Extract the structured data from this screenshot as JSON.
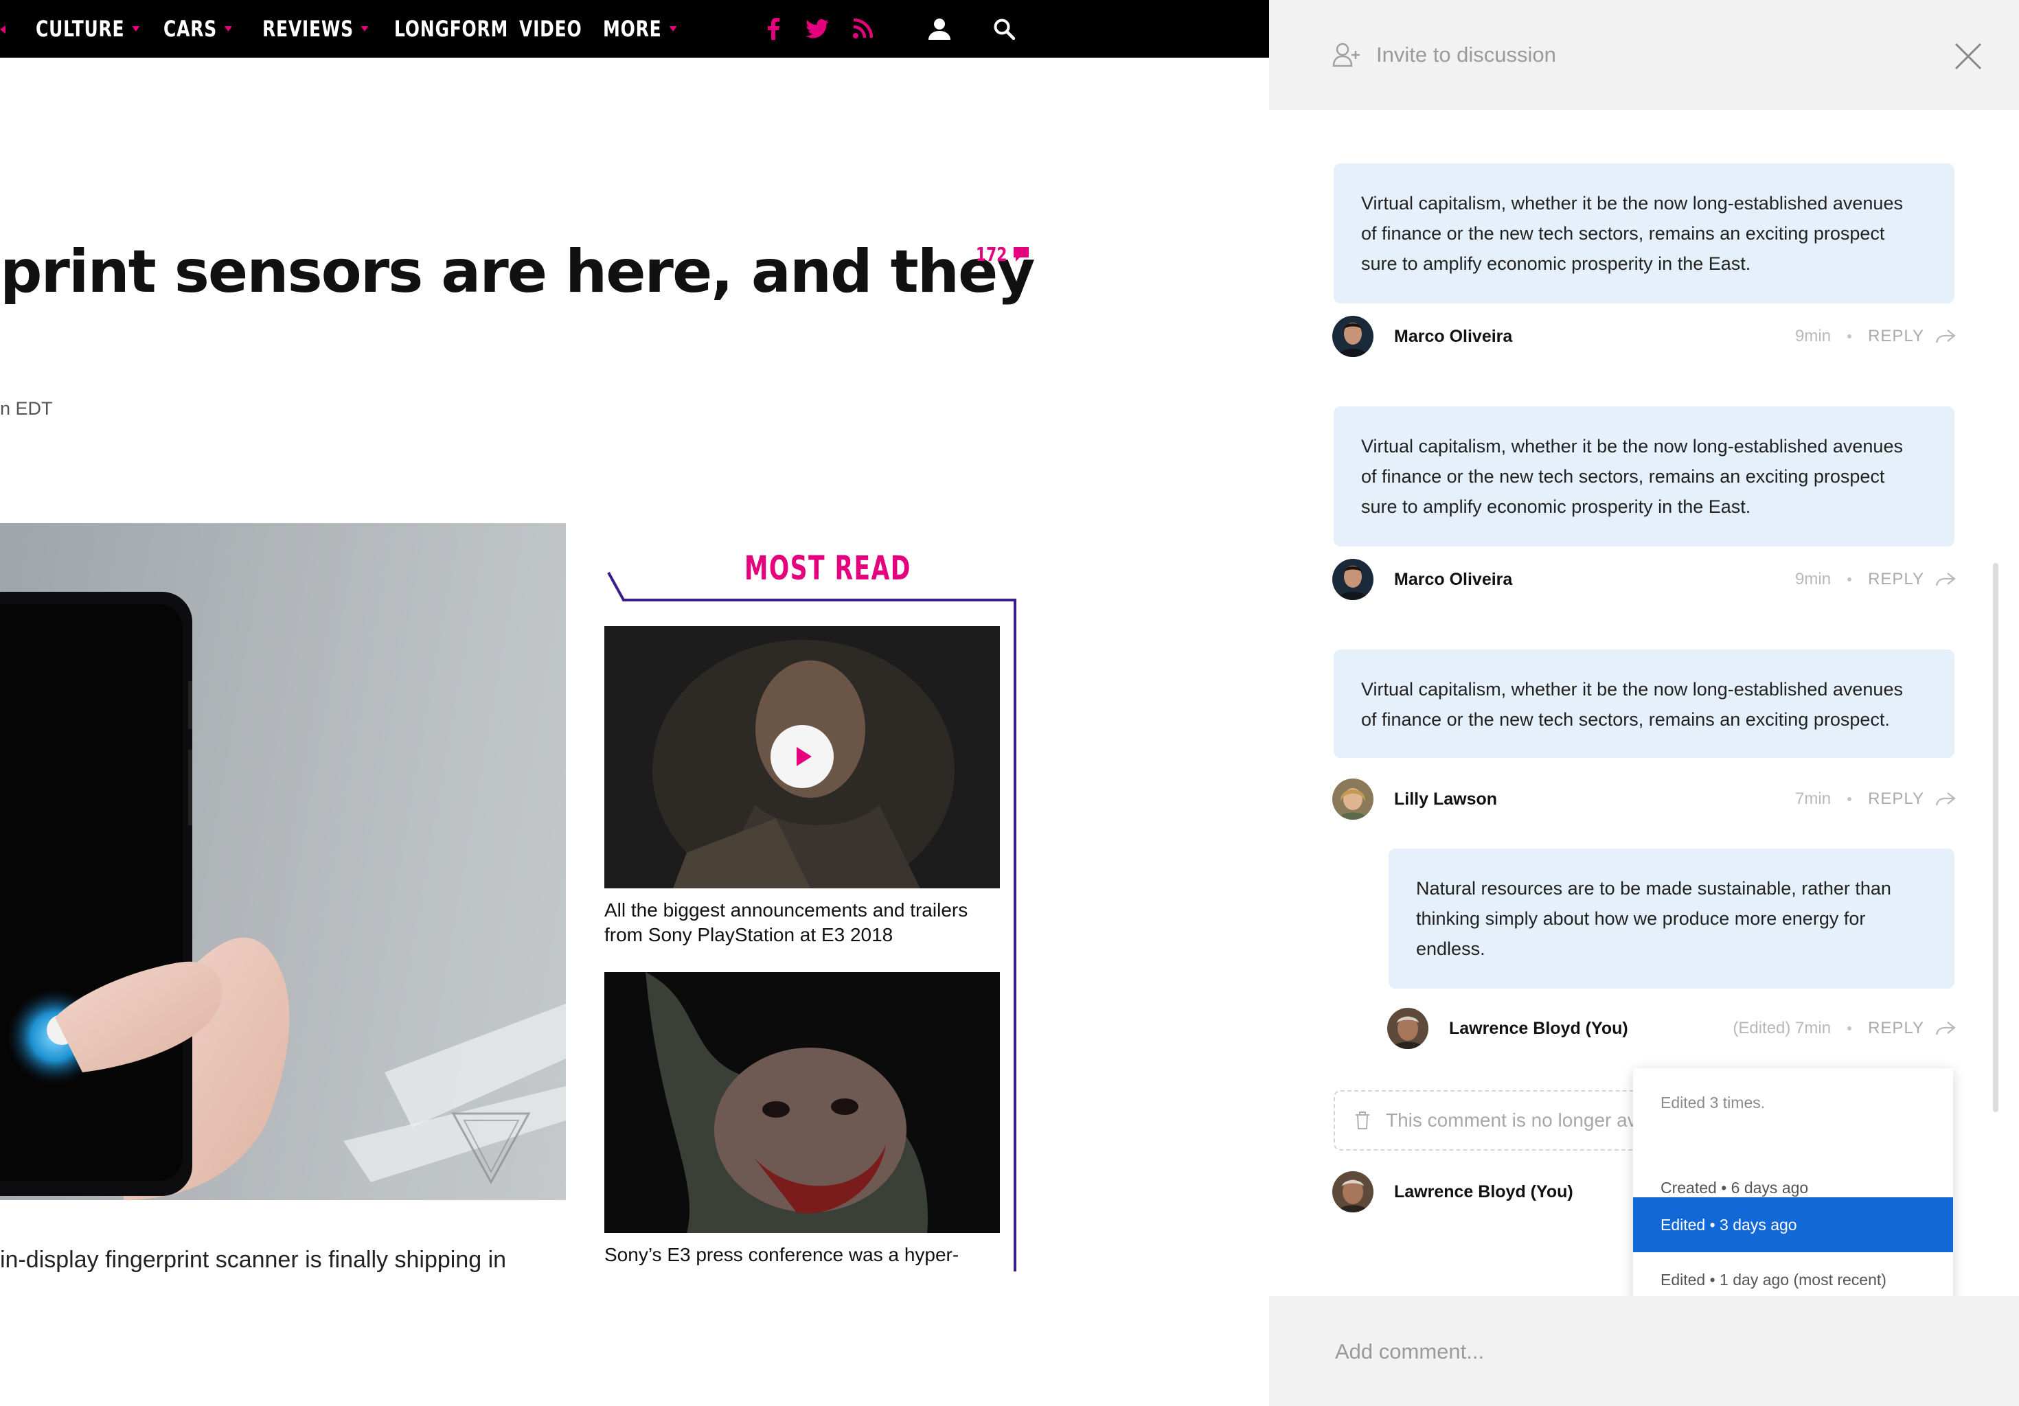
{
  "nav": {
    "items": [
      {
        "label": "CULTURE",
        "has_menu": true
      },
      {
        "label": "CARS",
        "has_menu": true
      },
      {
        "label": "REVIEWS",
        "has_menu": true
      },
      {
        "label": "LONGFORM",
        "has_menu": false
      },
      {
        "label": "VIDEO",
        "has_menu": false
      },
      {
        "label": "MORE",
        "has_menu": true
      }
    ],
    "social_icons": [
      "facebook-icon",
      "twitter-icon",
      "rss-icon"
    ],
    "utility_icons": [
      "user-icon",
      "search-icon"
    ],
    "accent_color": "#e5007d"
  },
  "article": {
    "headline": "print sensors are here, and they",
    "comment_count": "172",
    "timestamp": "n EDT",
    "body_preview": "in-display fingerprint scanner is finally shipping in"
  },
  "most_read": {
    "title": "MOST READ",
    "accent_color": "#3a1c8c",
    "items": [
      {
        "title": "All the biggest announcements and trailers from Sony PlayStation at E3 2018",
        "has_play_button": true
      },
      {
        "title": "Sony’s E3 press conference was a hyper-",
        "has_play_button": false
      }
    ]
  },
  "panel": {
    "invite_label": "Invite to discussion",
    "add_comment_placeholder": "Add comment...",
    "comments": [
      {
        "lines": [
          "Virtual capitalism, whether it be the now long-established avenues",
          "of finance or the new tech sectors, remains an exciting prospect",
          "sure to amplify economic prosperity in the East."
        ],
        "author": "Marco Oliveira",
        "time": "9min",
        "reply_label": "REPLY"
      },
      {
        "lines": [
          "Virtual capitalism, whether it be the now long-established avenues",
          "of finance or the new tech sectors, remains an exciting prospect",
          "sure to amplify economic prosperity in the East."
        ],
        "author": "Marco Oliveira",
        "time": "9min",
        "reply_label": "REPLY"
      },
      {
        "lines": [
          "Virtual capitalism, whether it be the now long-established avenues",
          "of finance or the new tech sectors, remains an exciting prospect."
        ],
        "author": "Lilly Lawson",
        "time": "7min",
        "reply_label": "REPLY"
      },
      {
        "lines": [
          "Natural resources are to be made sustainable, rather than",
          "thinking simply about how we produce more energy for",
          "endless."
        ],
        "author": "Lawrence Bloyd (You)",
        "time": "(Edited) 7min",
        "reply_label": "REPLY"
      }
    ],
    "deleted_comment": {
      "text": "This comment is no longer available.",
      "author": "Lawrence Bloyd (You)"
    },
    "edit_history": {
      "summary": "Edited 3 times.",
      "entries": [
        {
          "label": "Created • 6 days ago",
          "selected": false
        },
        {
          "label": "Edited • 3 days ago",
          "selected": true
        },
        {
          "label": "Edited • 1 day ago (most recent)",
          "selected": false
        }
      ],
      "highlight_color": "#1368d8"
    },
    "bubble_color": "#e6f0fa"
  }
}
